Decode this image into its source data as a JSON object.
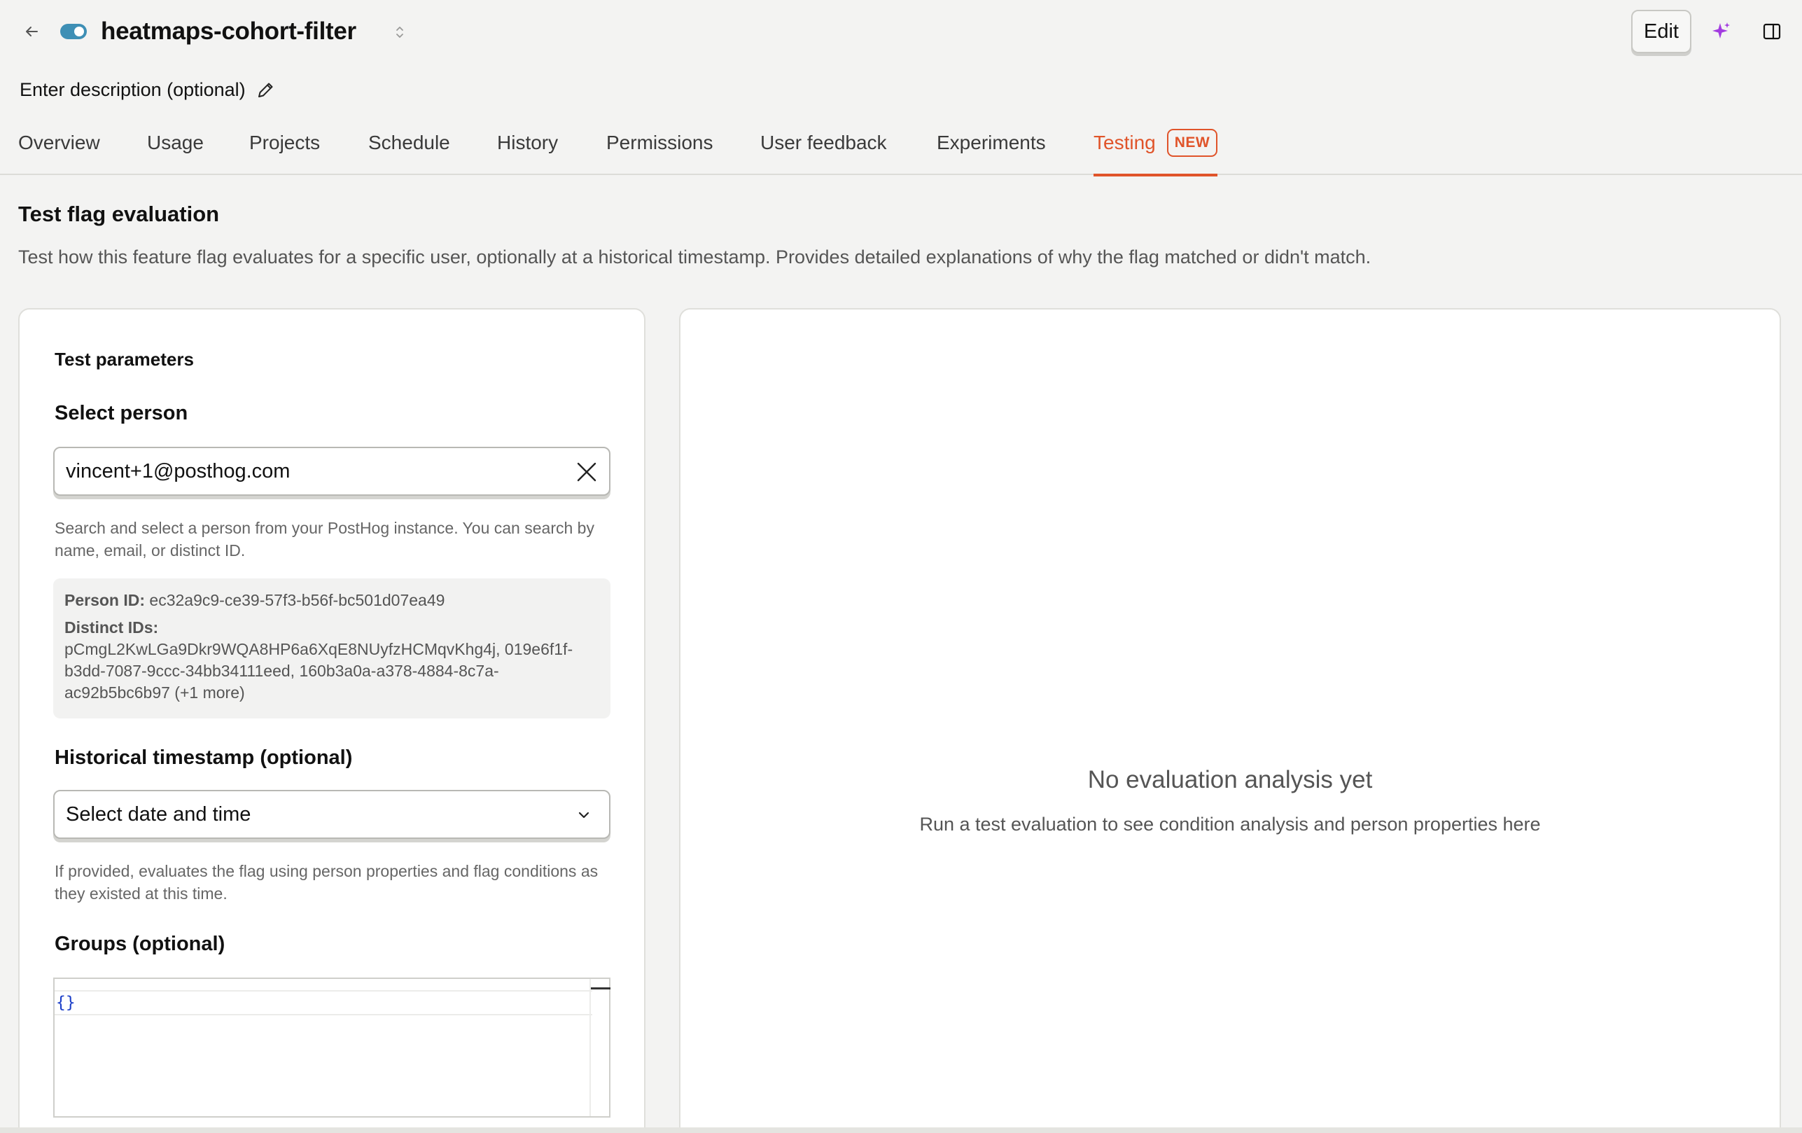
{
  "header": {
    "flag_name": "heatmaps-cohort-filter",
    "edit_label": "Edit",
    "description_placeholder": "Enter description (optional)"
  },
  "tabs": [
    {
      "label": "Overview"
    },
    {
      "label": "Usage"
    },
    {
      "label": "Projects"
    },
    {
      "label": "Schedule"
    },
    {
      "label": "History"
    },
    {
      "label": "Permissions"
    },
    {
      "label": "User feedback"
    },
    {
      "label": "Experiments"
    },
    {
      "label": "Testing",
      "badge": "NEW",
      "active": true
    }
  ],
  "section": {
    "title": "Test flag evaluation",
    "description": "Test how this feature flag evaluates for a specific user, optionally at a historical timestamp. Provides detailed explanations of why the flag matched or didn't match."
  },
  "params": {
    "title": "Test parameters",
    "person_label": "Select person",
    "person_value": "vincent+1@posthog.com",
    "person_help": "Search and select a person from your PostHog instance. You can search by name, email, or distinct ID.",
    "person_id_label": "Person ID:",
    "person_id": "ec32a9c9-ce39-57f3-b56f-bc501d07ea49",
    "distinct_ids_label": "Distinct IDs:",
    "distinct_ids": "pCmgL2KwLGa9Dkr9WQA8HP6a6XqE8NUyfzHCMqvKhg4j, 019e6f1f-b3dd-7087-9ccc-34bb34111eed, 160b3a0a-a378-4884-8c7a-ac92b5bc6b97 (+1 more)",
    "timestamp_label": "Historical timestamp (optional)",
    "timestamp_placeholder": "Select date and time",
    "timestamp_help": "If provided, evaluates the flag using person properties and flag conditions as they existed at this time.",
    "groups_label": "Groups (optional)",
    "groups_value": "{}"
  },
  "results": {
    "empty_title": "No evaluation analysis yet",
    "empty_subtitle": "Run a test evaluation to see condition analysis and person properties here"
  },
  "colors": {
    "accent": "#e0542a",
    "toggle": "#3e8fb5",
    "sparkle": "#a23be0"
  },
  "icons": {
    "back": "arrow-left-icon",
    "toggle": "toggle-on-icon",
    "caret": "chevron-up-down-icon",
    "edit_description": "pencil-icon",
    "ai": "sparkle-icon",
    "panel": "side-panel-icon",
    "clear": "close-icon",
    "chevron": "chevron-down-icon"
  }
}
